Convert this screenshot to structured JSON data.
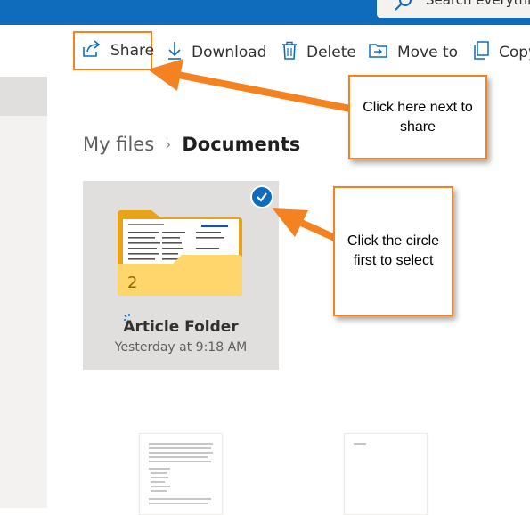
{
  "search": {
    "placeholder": "Search everythi"
  },
  "toolbar": {
    "share_label": "Share",
    "download_label": "Download",
    "delete_label": "Delete",
    "move_label": "Move to",
    "copy_label": "Copy"
  },
  "breadcrumb": {
    "parent": "My files",
    "current": "Documents"
  },
  "folder": {
    "name": "Article Folder",
    "modified": "Yesterday at 9:18 AM",
    "count": "2"
  },
  "callouts": {
    "share": "Click here next to share",
    "select": "Click the circle first to select"
  },
  "colors": {
    "accent": "#0f6cbd",
    "highlight": "#f58220",
    "folder": "#ffd66b"
  },
  "icons": [
    "search-icon",
    "share-icon",
    "download-icon",
    "delete-icon",
    "move-icon",
    "copy-icon",
    "checkmark-icon",
    "folder-icon",
    "sync-icon"
  ]
}
